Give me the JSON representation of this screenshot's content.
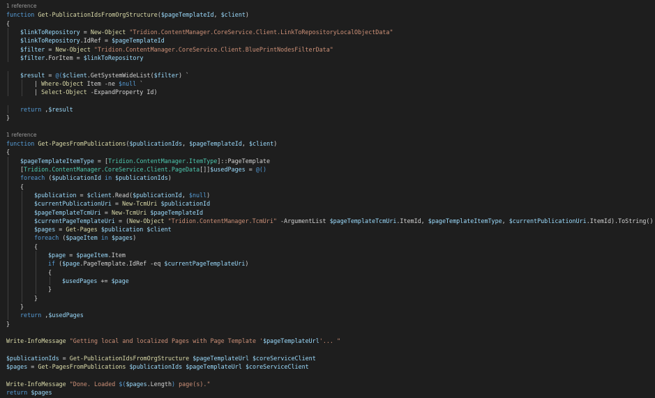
{
  "colors": {
    "background": "#1e1e1e",
    "default": "#d4d4d4",
    "keyword": "#569cd6",
    "function": "#dcdcaa",
    "variable": "#9cdcfe",
    "string": "#ce9178",
    "type": "#4ec9b0",
    "codelens": "#999999"
  },
  "lines": [
    {
      "codelens": "1 reference"
    },
    {
      "tokens": [
        [
          "function",
          "kw"
        ],
        [
          " "
        ],
        [
          "Get-PublicationIdsFromOrgStructure",
          "fn"
        ],
        [
          "("
        ],
        [
          "$pageTemplateId",
          "var"
        ],
        [
          ", "
        ],
        [
          "$client",
          "var"
        ],
        [
          ")"
        ]
      ]
    },
    {
      "tokens": [
        [
          "{"
        ]
      ]
    },
    {
      "indent": 1,
      "tokens": [
        [
          "$linkToRepository",
          "var"
        ],
        [
          " = "
        ],
        [
          "New-Object",
          "fn"
        ],
        [
          " "
        ],
        [
          "\"Tridion.ContentManager.CoreService.Client.LinkToRepositoryLocalObjectData\"",
          "str"
        ]
      ]
    },
    {
      "indent": 1,
      "tokens": [
        [
          "$linkToRepository",
          "var"
        ],
        [
          ".IdRef = "
        ],
        [
          "$pageTemplateId",
          "var"
        ]
      ]
    },
    {
      "indent": 1,
      "tokens": [
        [
          "$filter",
          "var"
        ],
        [
          " = "
        ],
        [
          "New-Object",
          "fn"
        ],
        [
          " "
        ],
        [
          "\"Tridion.ContentManager.CoreService.Client.BluePrintNodesFilterData\"",
          "str"
        ]
      ]
    },
    {
      "indent": 1,
      "tokens": [
        [
          "$filter",
          "var"
        ],
        [
          ".ForItem = "
        ],
        [
          "$linkToRepository",
          "var"
        ]
      ]
    },
    {
      "tokens": []
    },
    {
      "indent": 1,
      "tokens": [
        [
          "$result",
          "var"
        ],
        [
          " = "
        ],
        [
          "@(",
          "kw"
        ],
        [
          "$client",
          "var"
        ],
        [
          ".GetSystemWideList("
        ],
        [
          "$filter",
          "var"
        ],
        [
          ") `"
        ]
      ]
    },
    {
      "indent": 2,
      "tokens": [
        [
          "| "
        ],
        [
          "Where-Object",
          "fn"
        ],
        [
          " Item -ne "
        ],
        [
          "$null",
          "kw"
        ],
        [
          " `"
        ]
      ]
    },
    {
      "indent": 2,
      "tokens": [
        [
          "| "
        ],
        [
          "Select-Object",
          "fn"
        ],
        [
          " -ExpandProperty Id)"
        ]
      ]
    },
    {
      "tokens": []
    },
    {
      "indent": 1,
      "tokens": [
        [
          "return",
          "kw"
        ],
        [
          " ,"
        ],
        [
          "$result",
          "var"
        ]
      ]
    },
    {
      "tokens": [
        [
          "}"
        ]
      ]
    },
    {
      "tokens": []
    },
    {
      "codelens": "1 reference"
    },
    {
      "tokens": [
        [
          "function",
          "kw"
        ],
        [
          " "
        ],
        [
          "Get-PagesFromPublications",
          "fn"
        ],
        [
          "("
        ],
        [
          "$publicationIds",
          "var"
        ],
        [
          ", "
        ],
        [
          "$pageTemplateId",
          "var"
        ],
        [
          ", "
        ],
        [
          "$client",
          "var"
        ],
        [
          ")"
        ]
      ]
    },
    {
      "tokens": [
        [
          "{"
        ]
      ]
    },
    {
      "indent": 1,
      "tokens": [
        [
          "$pageTemplateItemType",
          "var"
        ],
        [
          " = ["
        ],
        [
          "Tridion.ContentManager.ItemType",
          "type"
        ],
        [
          "]::PageTemplate"
        ]
      ]
    },
    {
      "indent": 1,
      "tokens": [
        [
          "["
        ],
        [
          "Tridion.ContentManager.CoreService.Client.PageData",
          "type"
        ],
        [
          "[]]"
        ],
        [
          "$usedPages",
          "var"
        ],
        [
          " = "
        ],
        [
          "@()",
          "kw"
        ]
      ]
    },
    {
      "indent": 1,
      "tokens": [
        [
          "foreach",
          "kw"
        ],
        [
          " ("
        ],
        [
          "$publicationId",
          "var"
        ],
        [
          " "
        ],
        [
          "in",
          "kw"
        ],
        [
          " "
        ],
        [
          "$publicationIds",
          "var"
        ],
        [
          ")"
        ]
      ]
    },
    {
      "indent": 1,
      "tokens": [
        [
          "{"
        ]
      ]
    },
    {
      "indent": 2,
      "tokens": [
        [
          "$publication",
          "var"
        ],
        [
          " = "
        ],
        [
          "$client",
          "var"
        ],
        [
          ".Read("
        ],
        [
          "$publicationId",
          "var"
        ],
        [
          ", "
        ],
        [
          "$null",
          "kw"
        ],
        [
          ")"
        ]
      ]
    },
    {
      "indent": 2,
      "tokens": [
        [
          "$currentPublicationUri",
          "var"
        ],
        [
          " = "
        ],
        [
          "New-TcmUri",
          "fn"
        ],
        [
          " "
        ],
        [
          "$publicationId",
          "var"
        ]
      ]
    },
    {
      "indent": 2,
      "tokens": [
        [
          "$pageTemplateTcmUri",
          "var"
        ],
        [
          " = "
        ],
        [
          "New-TcmUri",
          "fn"
        ],
        [
          " "
        ],
        [
          "$pageTemplateId",
          "var"
        ]
      ]
    },
    {
      "indent": 2,
      "tokens": [
        [
          "$currentPageTemplateUri",
          "var"
        ],
        [
          " = ("
        ],
        [
          "New-Object",
          "fn"
        ],
        [
          " "
        ],
        [
          "\"Tridion.ContentManager.TcmUri\"",
          "str"
        ],
        [
          " -ArgumentList "
        ],
        [
          "$pageTemplateTcmUri",
          "var"
        ],
        [
          ".ItemId, "
        ],
        [
          "$pageTemplateItemType",
          "var"
        ],
        [
          ", "
        ],
        [
          "$currentPublicationUri",
          "var"
        ],
        [
          ".ItemId).ToString()"
        ]
      ]
    },
    {
      "indent": 2,
      "tokens": [
        [
          "$pages",
          "var"
        ],
        [
          " = "
        ],
        [
          "Get-Pages",
          "fn"
        ],
        [
          " "
        ],
        [
          "$publication",
          "var"
        ],
        [
          " "
        ],
        [
          "$client",
          "var"
        ]
      ]
    },
    {
      "indent": 2,
      "tokens": [
        [
          "foreach",
          "kw"
        ],
        [
          " ("
        ],
        [
          "$pageItem",
          "var"
        ],
        [
          " "
        ],
        [
          "in",
          "kw"
        ],
        [
          " "
        ],
        [
          "$pages",
          "var"
        ],
        [
          ")"
        ]
      ]
    },
    {
      "indent": 2,
      "tokens": [
        [
          "{"
        ]
      ]
    },
    {
      "indent": 3,
      "tokens": [
        [
          "$page",
          "var"
        ],
        [
          " = "
        ],
        [
          "$pageItem",
          "var"
        ],
        [
          ".Item"
        ]
      ]
    },
    {
      "indent": 3,
      "tokens": [
        [
          "if",
          "kw"
        ],
        [
          " ("
        ],
        [
          "$page",
          "var"
        ],
        [
          ".PageTemplate.IdRef -eq "
        ],
        [
          "$currentPageTemplateUri",
          "var"
        ],
        [
          ")"
        ]
      ]
    },
    {
      "indent": 3,
      "tokens": [
        [
          "{"
        ]
      ]
    },
    {
      "indent": 4,
      "tokens": [
        [
          "$usedPages",
          "var"
        ],
        [
          " += "
        ],
        [
          "$page",
          "var"
        ]
      ]
    },
    {
      "indent": 3,
      "tokens": [
        [
          "}"
        ]
      ]
    },
    {
      "indent": 2,
      "tokens": [
        [
          "}"
        ]
      ]
    },
    {
      "indent": 1,
      "tokens": [
        [
          "}"
        ]
      ]
    },
    {
      "indent": 1,
      "tokens": [
        [
          "return",
          "kw"
        ],
        [
          " ,"
        ],
        [
          "$usedPages",
          "var"
        ]
      ]
    },
    {
      "tokens": [
        [
          "}"
        ]
      ]
    },
    {
      "tokens": []
    },
    {
      "tokens": [
        [
          "Write-InfoMessage",
          "fn"
        ],
        [
          " "
        ],
        [
          "\"Getting local and localized Pages with Page Template '",
          "str"
        ],
        [
          "$pageTemplateUrl",
          "var"
        ],
        [
          "'... \"",
          "str"
        ]
      ]
    },
    {
      "tokens": []
    },
    {
      "tokens": [
        [
          "$publicationIds",
          "var"
        ],
        [
          " = "
        ],
        [
          "Get-PublicationIdsFromOrgStructure",
          "fn"
        ],
        [
          " "
        ],
        [
          "$pageTemplateUrl",
          "var"
        ],
        [
          " "
        ],
        [
          "$coreServiceClient",
          "var"
        ]
      ]
    },
    {
      "tokens": [
        [
          "$pages",
          "var"
        ],
        [
          " = "
        ],
        [
          "Get-PagesFromPublications",
          "fn"
        ],
        [
          " "
        ],
        [
          "$publicationIds",
          "var"
        ],
        [
          " "
        ],
        [
          "$pageTemplateUrl",
          "var"
        ],
        [
          " "
        ],
        [
          "$coreServiceClient",
          "var"
        ]
      ]
    },
    {
      "tokens": []
    },
    {
      "tokens": [
        [
          "Write-InfoMessage",
          "fn"
        ],
        [
          " "
        ],
        [
          "\"Done. Loaded ",
          "str"
        ],
        [
          "$(",
          "kw"
        ],
        [
          "$pages",
          "var"
        ],
        [
          ".Length"
        ],
        [
          ")",
          "kw"
        ],
        [
          " page(s).\"",
          "str"
        ]
      ]
    },
    {
      "tokens": [
        [
          "return",
          "kw"
        ],
        [
          " "
        ],
        [
          "$pages",
          "var"
        ]
      ]
    }
  ]
}
